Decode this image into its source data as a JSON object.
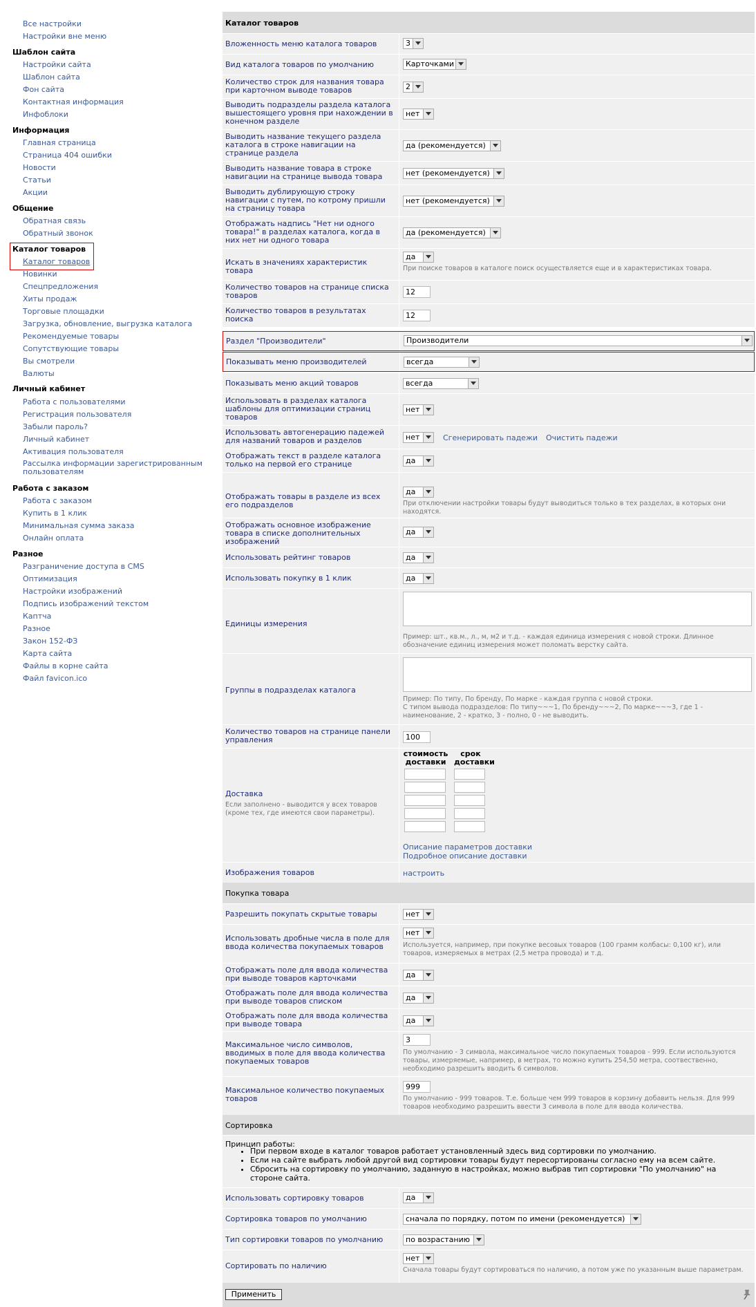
{
  "sidebar": {
    "top": [
      "Все настройки",
      "Настройки вне меню"
    ],
    "groups": [
      {
        "title": "Шаблон сайта",
        "items": [
          "Настройки сайта",
          "Шаблон сайта",
          "Фон сайта",
          "Контактная информация",
          "Инфоблоки"
        ]
      },
      {
        "title": "Информация",
        "items": [
          "Главная страница",
          "Страница 404 ошибки",
          "Новости",
          "Статьи",
          "Акции"
        ]
      },
      {
        "title": "Общение",
        "items": [
          "Обратная связь",
          "Обратный звонок"
        ]
      },
      {
        "title": "Каталог товаров",
        "items": [
          "Каталог товаров",
          "Новинки",
          "Спецпредложения",
          "Хиты продаж",
          "Торговые площадки",
          "Загрузка, обновление, выгрузка каталога",
          "Рекомендуемые товары",
          "Сопутствующие товары",
          "Вы смотрели",
          "Валюты"
        ]
      },
      {
        "title": "Личный кабинет",
        "items": [
          "Работа с пользователями",
          "Регистрация пользователя",
          "Забыли пароль?",
          "Личный кабинет",
          "Активация пользователя",
          "Рассылка информации зарегистрированным пользователям"
        ]
      },
      {
        "title": "Работа с заказом",
        "items": [
          "Работа с заказом",
          "Купить в 1 клик",
          "Минимальная сумма заказа",
          "Онлайн оплата"
        ]
      },
      {
        "title": "Разное",
        "items": [
          "Разграничение доступа в CMS",
          "Оптимизация",
          "Настройки изображений",
          "Подпись изображений текстом",
          "Каптча",
          "Разное",
          "Закон 152-ФЗ",
          "Карта сайта",
          "Файлы в корне сайта",
          "Файл favicon.ico"
        ]
      }
    ]
  },
  "main": {
    "section1": "Каталог товаров",
    "rows": [
      {
        "label": "Вложенность меню каталога товаров",
        "value": "3"
      },
      {
        "label": "Вид каталога товаров по умолчанию",
        "value": "Карточками"
      },
      {
        "label": "Количество строк для названия товара при карточном выводе товаров",
        "value": "2"
      },
      {
        "label": "Выводить подразделы раздела каталога вышестоящего уровня при нахождении в конечном разделе",
        "value": "нет"
      },
      {
        "label": "Выводить название текущего раздела каталога в строке навигации на странице раздела",
        "value": "да (рекомендуется)"
      },
      {
        "label": "Выводить название товара в строке навигации на странице вывода товара",
        "value": "нет (рекомендуется)"
      },
      {
        "label": "Выводить дублирующую строку навигации с путем, по котрому пришли на страницу товара",
        "value": "нет (рекомендуется)"
      },
      {
        "label": "Отображать надпись \"Нет ни одного товара!\" в разделах каталога, когда в них нет ни одного товара",
        "value": "да (рекомендуется)"
      },
      {
        "label": "Искать в значениях характеристик товара",
        "value": "да",
        "hint": "При поиске товаров в каталоге поиск осуществляется еще и в характеристиках товара."
      },
      {
        "label": "Количество товаров на странице списка товаров",
        "value": "12"
      },
      {
        "label": "Количество товаров в результатах поиска",
        "value": "12"
      },
      {
        "label": "Раздел \"Производители\"",
        "value": "Производители"
      },
      {
        "label": "Показывать меню производителей",
        "value": "всегда"
      },
      {
        "label": "Показывать меню акций товаров",
        "value": "всегда"
      },
      {
        "label": "Использовать в разделах каталога шаблоны для оптимизации страниц товаров",
        "value": "нет"
      },
      {
        "label": "Использовать автогенерацию падежей для названий товаров и разделов",
        "value": "нет",
        "link1": "Сгенерировать падежи",
        "link2": "Очистить падежи"
      },
      {
        "label": "Отображать текст в разделе каталога только на первой его странице",
        "value": "да"
      },
      {
        "label": "Отображать товары в разделе из всех его подразделов",
        "value": "да",
        "hint": "При отключении настройки товары будут выводиться только в тех разделах, в которых они находятся."
      },
      {
        "label": "Отображать основное изображение товара в списке дополнительных изображений",
        "value": "да"
      },
      {
        "label": "Использовать рейтинг товаров",
        "value": "да"
      },
      {
        "label": "Использовать покупку в 1 клик",
        "value": "да"
      },
      {
        "label": "Единицы измерения",
        "hint": "Пример: шт., кв.м., л., м, м2 и т.д. - каждая единица измерения с новой строки. Длинное обозначение единиц измерения может поломать верстку сайта."
      },
      {
        "label": "Группы в подразделах каталога",
        "hint1": "Пример: По типу, По бренду, По марке - каждая группа с новой строки.",
        "hint2": "С типом вывода подразделов: По типу~~~1, По бренду~~~2, По марке~~~3, где 1 - наименование, 2 - кратко, 3 - полно, 0 - не выводить."
      },
      {
        "label": "Количество товаров на странице панели управления",
        "value": "100"
      },
      {
        "label": "Доставка",
        "hint": "Если заполнено - выводится у всех товаров (кроме тех, где имеются свои параметры).",
        "col1": "стоимость доставки",
        "col2": "срок доставки",
        "link1": "Описание параметров доставки",
        "link2": "Подробное описание доставки"
      },
      {
        "label": "Изображения товаров",
        "link": "настроить"
      }
    ],
    "section2": "Покупка товара",
    "rows2": [
      {
        "label": "Разрешить покупать скрытые товары",
        "value": "нет"
      },
      {
        "label": "Использовать дробные числа в поле для ввода количества покупаемых товаров",
        "value": "нет",
        "hint": "Используется, например, при покупке весовых товаров (100 грамм колбасы: 0,100 кг), или товаров, измеряемых в метрах (2,5 метра провода) и т.д."
      },
      {
        "label": "Отображать поле для ввода количества при выводе товаров карточками",
        "value": "да"
      },
      {
        "label": "Отображать поле для ввода количества при выводе товаров списком",
        "value": "да"
      },
      {
        "label": "Отображать поле для ввода количества при выводе товара",
        "value": "да"
      },
      {
        "label": "Максимальное число символов, вводимых в поле для ввода количества покупаемых товаров",
        "value": "3",
        "hint": "По умолчанию - 3 символа, максимальное число покупаемых товаров - 999. Если используются товары, измеряемые, например, в метрах, то можно купить 254,50 метра, соотвественно, необходимо разрешить вводить 6 символов."
      },
      {
        "label": "Максимальное количество покупаемых товаров",
        "value": "999",
        "hint": "По умолчанию - 999 товаров. Т.е. больше чем 999 товаров в корзину добавить нельзя. Для 999 товаров необходимо разрешить ввести 3 символа в поле для ввода количества."
      }
    ],
    "section3": "Сортировка",
    "sort_intro": "Принцип работы:",
    "sort_bullets": [
      "При первом входе в каталог товаров работает установленный здесь вид сортировки по умолчанию.",
      "Если на сайте выбрать любой другой вид сортировки товары будут пересортированы согласно ему на всем сайте.",
      "Сбросить на сортировку по умолчанию, заданную в настройках, можно выбрав тип сортировки \"По умолчанию\" на стороне сайта."
    ],
    "rows3": [
      {
        "label": "Использовать сортировку товаров",
        "value": "да"
      },
      {
        "label": "Сортировка товаров по умолчанию",
        "value": "сначала по порядку, потом по имени (рекомендуется)"
      },
      {
        "label": "Тип сортировки товаров по умолчанию",
        "value": "по возрастанию"
      },
      {
        "label": "Сортировать по наличию",
        "value": "нет",
        "hint": "Сначала товары будут сортироваться по наличию, а потом уже по указанным выше параметрам."
      }
    ],
    "apply": "Применить"
  },
  "colors": {
    "link": "#3a5a9a",
    "label": "#1e2a78",
    "row_bg": "#f0f0f0",
    "section_bg": "#dcdcdc",
    "highlight": "#dd0000"
  }
}
